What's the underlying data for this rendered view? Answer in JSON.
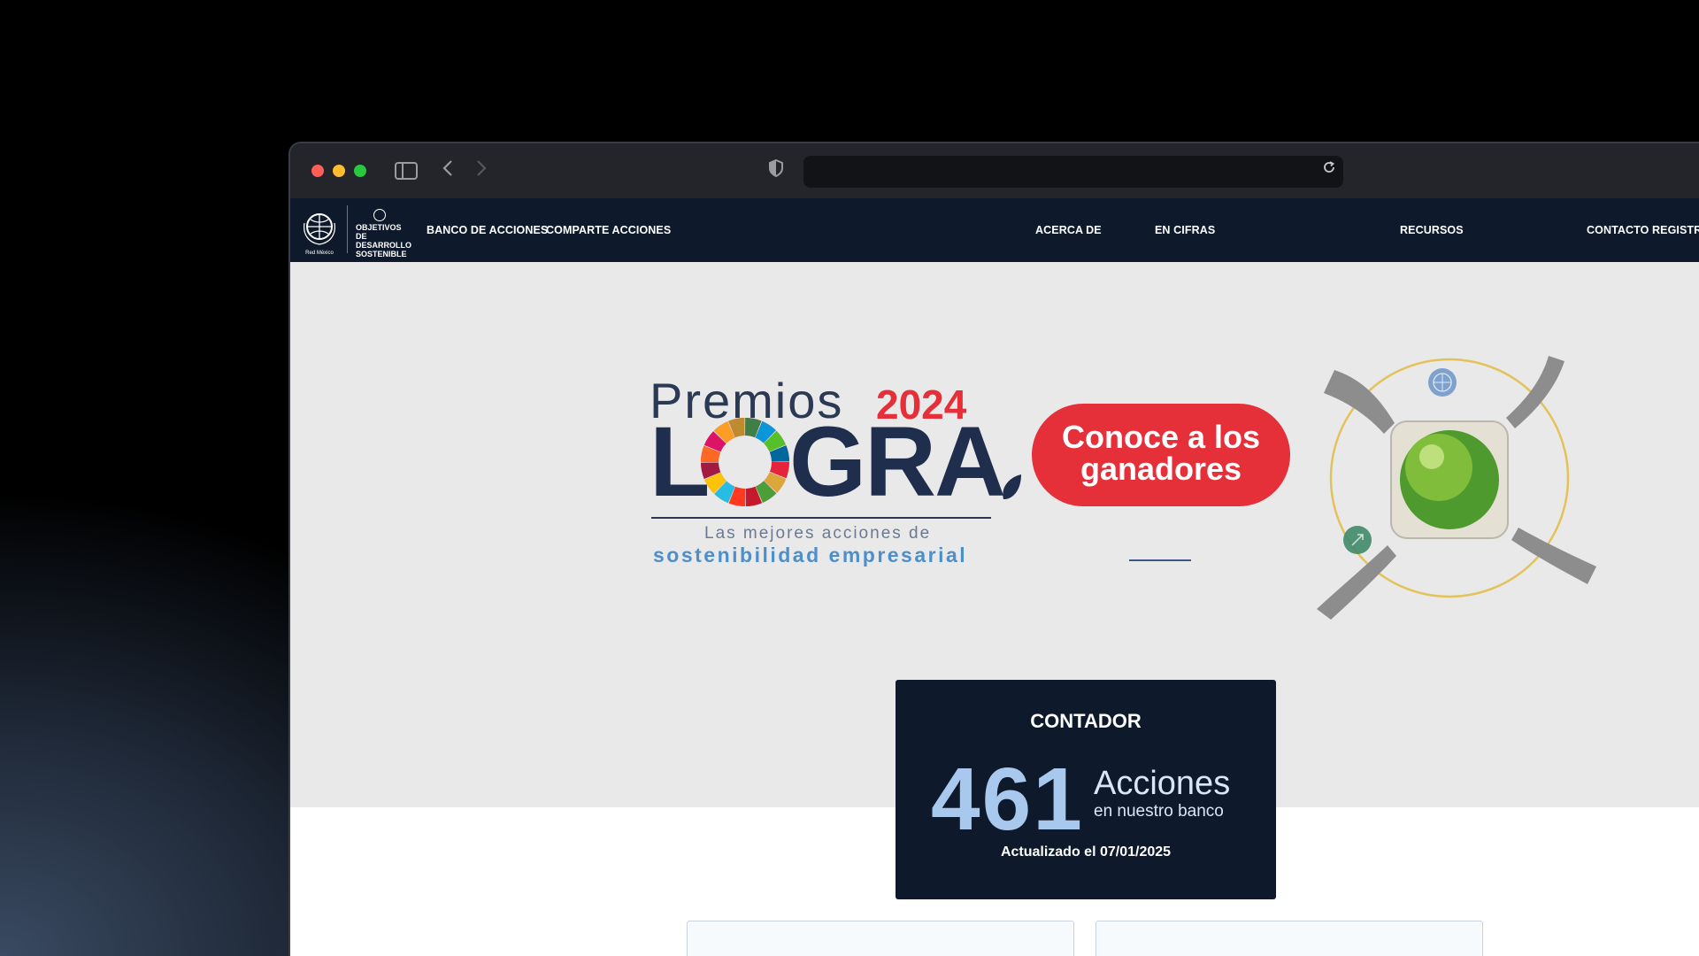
{
  "nav": {
    "items": [
      {
        "label": "BANCO DE ACCIONES"
      },
      {
        "label": "COMPARTE ACCIONES"
      },
      {
        "label": "ACERCA DE"
      },
      {
        "label": "EN CIFRAS"
      },
      {
        "label": "RECURSOS"
      },
      {
        "label": "CONTACTO"
      },
      {
        "label": "REGISTRO"
      }
    ],
    "logo_ods_text": "OBJETIVOS DE DESARROLLO SOSTENIBLE",
    "logo_gc_text": "Red México"
  },
  "hero": {
    "premios": "Premios",
    "year": "2024",
    "logra": "LOGRA",
    "tagline_line1": "Las mejores acciones de",
    "tagline_line2": "sostenibilidad empresarial",
    "cta_line1": "Conoce a los",
    "cta_line2": "ganadores"
  },
  "counter": {
    "title": "CONTADOR",
    "value": "461",
    "unit": "Acciones",
    "subtitle": "en nuestro banco",
    "updated": "Actualizado el 07/01/2025"
  },
  "colors": {
    "navbar": "#0e1a2b",
    "accent_red": "#e5303a",
    "hero_bg": "#e9e9ea",
    "counter_number": "#a8c8ee"
  }
}
